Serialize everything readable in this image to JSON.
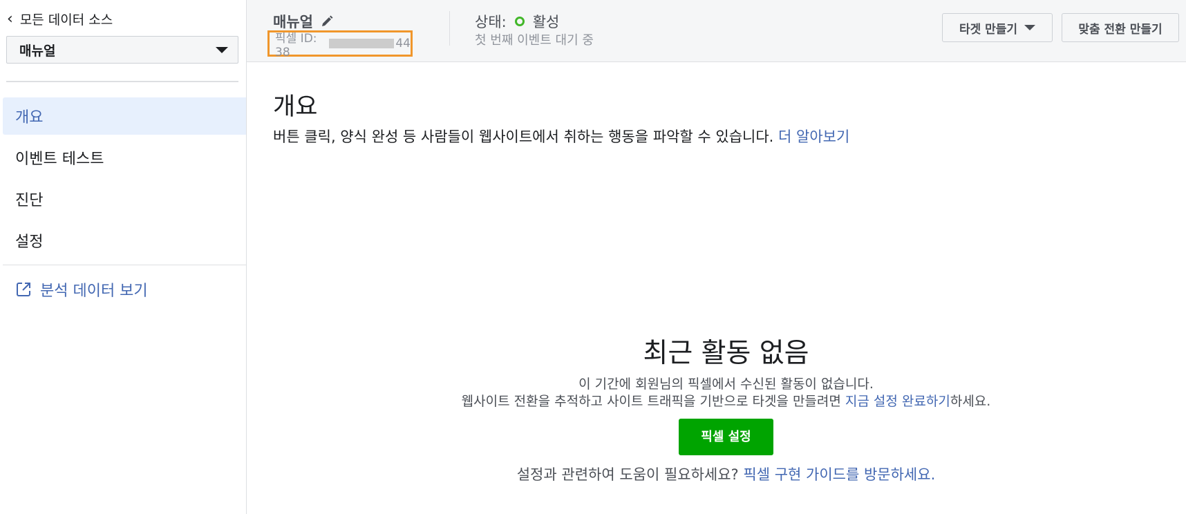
{
  "sidebar": {
    "back_label": "모든 데이터 소스",
    "source_select": {
      "value": "매뉴얼"
    },
    "items": [
      {
        "label": "개요",
        "active": true
      },
      {
        "label": "이벤트 테스트",
        "active": false
      },
      {
        "label": "진단",
        "active": false
      },
      {
        "label": "설정",
        "active": false
      }
    ],
    "analytics_link": "분석 데이터 보기"
  },
  "header": {
    "pixel_name": "매뉴얼",
    "pixel_id_prefix": "픽셀 ID: 38",
    "pixel_id_suffix": "44",
    "status_label": "상태:",
    "status_value": "활성",
    "status_sub": "첫 번째 이벤트 대기 중",
    "create_audience_button": "타겟 만들기",
    "create_conversion_button": "맞춤 전환 만들기"
  },
  "main": {
    "title": "개요",
    "description": "버튼 클릭, 양식 완성 등 사람들이 웹사이트에서 취하는 행동을 파악할 수 있습니다.",
    "learn_more": "더 알아보기",
    "empty": {
      "title": "최근 활동 없음",
      "line1": "이 기간에 회원님의 픽셀에서 수신된 활동이 없습니다.",
      "line2_prefix": "웹사이트 전환을 추적하고 사이트 트래픽을 기반으로 타겟을 만들려면 ",
      "line2_link": "지금 설정 완료하기",
      "line2_suffix": "하세요.",
      "button": "픽셀 설정",
      "help_prefix": "설정과 관련하여 도움이 필요하세요? ",
      "help_link": "픽셀 구현 가이드를 방문하세요."
    }
  },
  "colors": {
    "accent": "#4267b2",
    "success": "#00a400",
    "status_active": "#42b72a",
    "highlight_box": "#f0962b"
  }
}
